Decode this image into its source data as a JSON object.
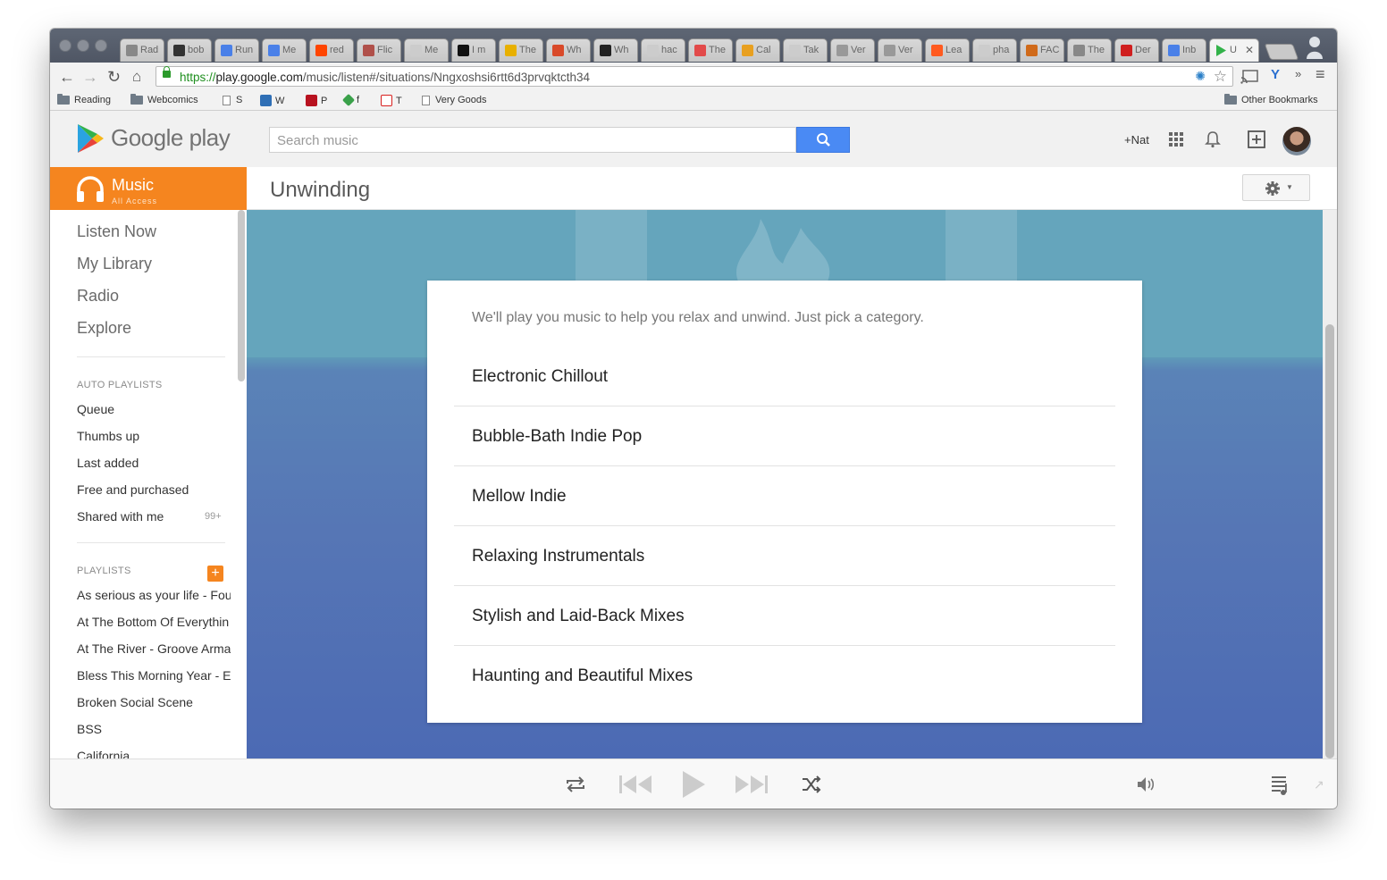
{
  "browser": {
    "tabs": [
      {
        "title": "Rad",
        "color": "#888888"
      },
      {
        "title": "bob",
        "color": "#333333"
      },
      {
        "title": "Run",
        "color": "#4a80e8"
      },
      {
        "title": "Me",
        "color": "#4a80e8"
      },
      {
        "title": "red",
        "color": "#ff4500"
      },
      {
        "title": "Flic",
        "color": "#b0504a"
      },
      {
        "title": "Me",
        "color": "#cccccc"
      },
      {
        "title": "I m",
        "color": "#111111"
      },
      {
        "title": "The",
        "color": "#e8b000"
      },
      {
        "title": "Wh",
        "color": "#d94a2a"
      },
      {
        "title": "Wh",
        "color": "#222222"
      },
      {
        "title": "hac",
        "color": "#cccccc"
      },
      {
        "title": "The",
        "color": "#e24a4a"
      },
      {
        "title": "Cal",
        "color": "#e8a020"
      },
      {
        "title": "Tak",
        "color": "#cccccc"
      },
      {
        "title": "Ver",
        "color": "#999999"
      },
      {
        "title": "Ver",
        "color": "#999999"
      },
      {
        "title": "Lea",
        "color": "#ff5a1f"
      },
      {
        "title": "pha",
        "color": "#cccccc"
      },
      {
        "title": "FAC",
        "color": "#d06a1a"
      },
      {
        "title": "The",
        "color": "#888888"
      },
      {
        "title": "Der",
        "color": "#d01f1f"
      },
      {
        "title": "Inb",
        "color": "#4a80e8"
      }
    ],
    "active_tab": {
      "title": "U"
    },
    "url": {
      "scheme": "https://",
      "host": "play.google.com",
      "path": "/music/listen#/situations/Nngxoshsi6rtt6d3prvqktcth34"
    },
    "bookmarks": [
      {
        "label": "Reading",
        "kind": "folder"
      },
      {
        "label": "Webcomics",
        "kind": "folder"
      },
      {
        "label": "S",
        "kind": "page"
      },
      {
        "label": "W",
        "kind": "icon",
        "color": "#2f6fb5"
      },
      {
        "label": "P",
        "kind": "icon",
        "color": "#b8121f"
      },
      {
        "label": "f",
        "kind": "icon",
        "color": "#3aa14a"
      },
      {
        "label": "T",
        "kind": "icon",
        "color": "#d8201f"
      },
      {
        "label": "Very Goods",
        "kind": "page"
      }
    ],
    "other_bookmarks": "Other Bookmarks"
  },
  "header": {
    "logo_text": "Google play",
    "search_placeholder": "Search music",
    "plus_user": "+Nat"
  },
  "section": {
    "badge_label": "Music",
    "badge_sub": "All Access",
    "title": "Unwinding"
  },
  "sidebar": {
    "nav": [
      "Listen Now",
      "My Library",
      "Radio",
      "Explore"
    ],
    "auto_playlists_heading": "AUTO PLAYLISTS",
    "auto_playlists": [
      "Queue",
      "Thumbs up",
      "Last added",
      "Free and purchased",
      "Shared with me"
    ],
    "shared_count": "99+",
    "playlists_heading": "PLAYLISTS",
    "playlists": [
      "As serious as your life - Fou",
      "At The Bottom Of Everythin",
      "At The River - Groove Arma",
      "Bless This Morning Year - E",
      "Broken Social Scene",
      "BSS",
      "California"
    ]
  },
  "card": {
    "intro": "We'll play you music to help you relax and unwind. Just pick a category.",
    "categories": [
      "Electronic Chillout",
      "Bubble-Bath Indie Pop",
      "Mellow Indie",
      "Relaxing Instrumentals",
      "Stylish and Laid-Back Mixes",
      "Haunting and Beautiful Mixes"
    ]
  },
  "colors": {
    "accent": "#f5851f",
    "search_button": "#4a8af4",
    "hero_top": "#65a5bc",
    "hero_bottom": "#4c6ab4"
  }
}
